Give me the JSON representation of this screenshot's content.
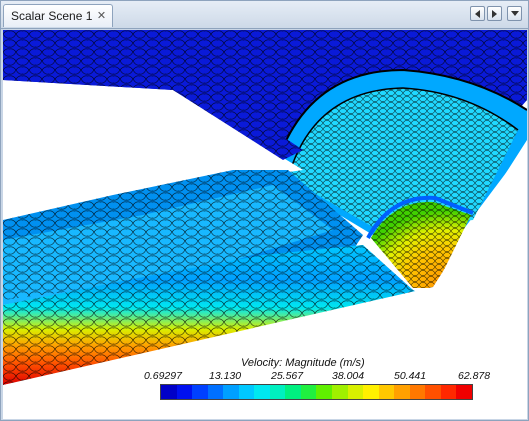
{
  "tab": {
    "title": "Scalar Scene 1",
    "close_glyph": "✕"
  },
  "nav_buttons": [
    "scroll-left-icon",
    "scroll-right-icon",
    "list-tabs-icon"
  ],
  "legend": {
    "title": "Velocity: Magnitude (m/s)",
    "ticks": [
      "0.69297",
      "13.130",
      "25.567",
      "38.004",
      "50.441",
      "62.878"
    ],
    "colors": [
      "#0000c8",
      "#0010f0",
      "#0040ff",
      "#0070ff",
      "#00a0ff",
      "#00c8ff",
      "#00e8f0",
      "#00f0c0",
      "#00f080",
      "#20f040",
      "#60f000",
      "#a0f000",
      "#d8f000",
      "#fff000",
      "#ffc800",
      "#ffa000",
      "#ff7800",
      "#ff5000",
      "#ff2800",
      "#f00000"
    ]
  }
}
